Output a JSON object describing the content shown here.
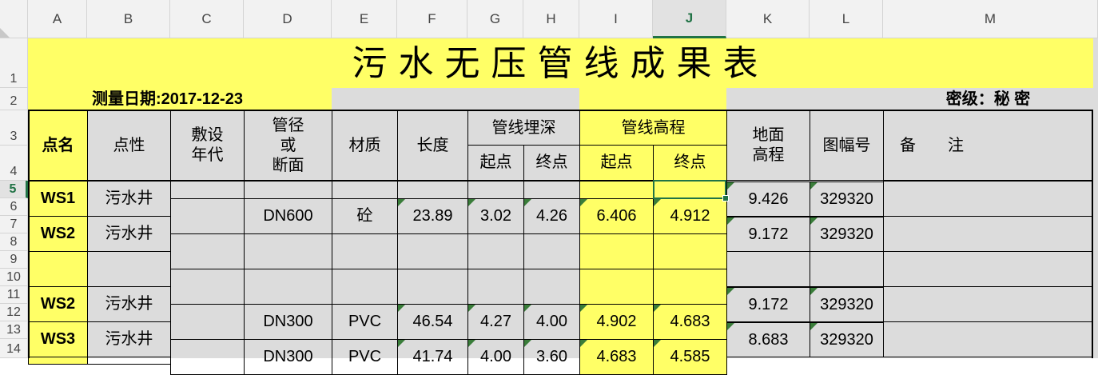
{
  "columns": [
    "A",
    "B",
    "C",
    "D",
    "E",
    "F",
    "G",
    "H",
    "I",
    "J",
    "K",
    "L",
    "M"
  ],
  "rows": [
    "1",
    "2",
    "3",
    "4",
    "5",
    "6",
    "7",
    "8",
    "9",
    "10",
    "11",
    "12",
    "13",
    "14"
  ],
  "selected_cell": "J5",
  "title": "污水无压管线成果表",
  "survey_date": "测量日期:2017-12-23",
  "security_level": "密级：秘 密",
  "headers": {
    "point_name": "点名",
    "point_type": "点性",
    "laying_year": "敷设\n年代",
    "pipe_size": "管径\n或\n断面",
    "material": "材质",
    "length": "长度",
    "burial_depth": "管线埋深",
    "elevation": "管线高程",
    "start": "起点",
    "end": "终点",
    "start2": "起点",
    "end2": "终点",
    "ground_elev": "地面\n高程",
    "map_sheet": "图幅号",
    "remarks": "备　　注"
  },
  "points": [
    {
      "name": "WS1",
      "type": "污水井",
      "ground": "9.426",
      "sheet": "329320"
    },
    {
      "name": "WS2",
      "type": "污水井",
      "ground": "9.172",
      "sheet": "329320"
    },
    {
      "name": "WS2",
      "type": "污水井",
      "ground": "9.172",
      "sheet": "329320"
    },
    {
      "name": "WS3",
      "type": "污水井",
      "ground": "8.683",
      "sheet": "329320"
    }
  ],
  "segments": [
    {
      "size": "DN600",
      "material": "砼",
      "length": "23.89",
      "depth_start": "3.02",
      "depth_end": "4.26",
      "elev_start": "6.406",
      "elev_end": "4.912"
    },
    {
      "size": "DN300",
      "material": "PVC",
      "length": "46.54",
      "depth_start": "4.27",
      "depth_end": "4.00",
      "elev_start": "4.902",
      "elev_end": "4.683"
    },
    {
      "size": "DN300",
      "material": "PVC",
      "length": "41.74",
      "depth_start": "4.00",
      "depth_end": "3.60",
      "elev_start": "4.683",
      "elev_end": "4.585"
    }
  ]
}
